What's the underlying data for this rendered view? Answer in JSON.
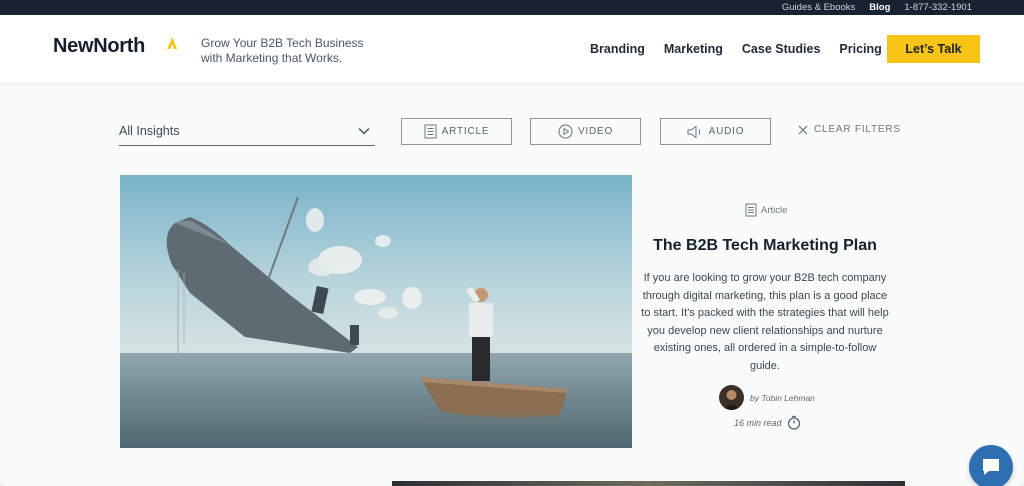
{
  "topbar": {
    "links": [
      "Guides & Ebooks",
      "Blog",
      "1-877-332-1901"
    ]
  },
  "header": {
    "logo": "NewNorth",
    "tagline_line1": "Grow Your B2B Tech Business",
    "tagline_line2": "with Marketing that Works.",
    "nav": [
      "Branding",
      "Marketing",
      "Case Studies",
      "Pricing"
    ],
    "cta": "Let’s Talk",
    "accent_color": "#f8c516"
  },
  "filters": {
    "select_value": "All Insights",
    "buttons": [
      "ARTICLE",
      "VIDEO",
      "AUDIO"
    ],
    "clear": "CLEAR FILTERS"
  },
  "featured": {
    "type": "Article",
    "title": "The B2B Tech Marketing Plan",
    "description": "If you are looking to grow your B2B tech company through digital marketing, this plan is a good place to start. It’s packed with the strategies that will help you develop new client relationships and nurture existing ones, all ordered in a simple-to-follow guide.",
    "author": "by Tobin Lehman",
    "read_time": "16 min read"
  }
}
